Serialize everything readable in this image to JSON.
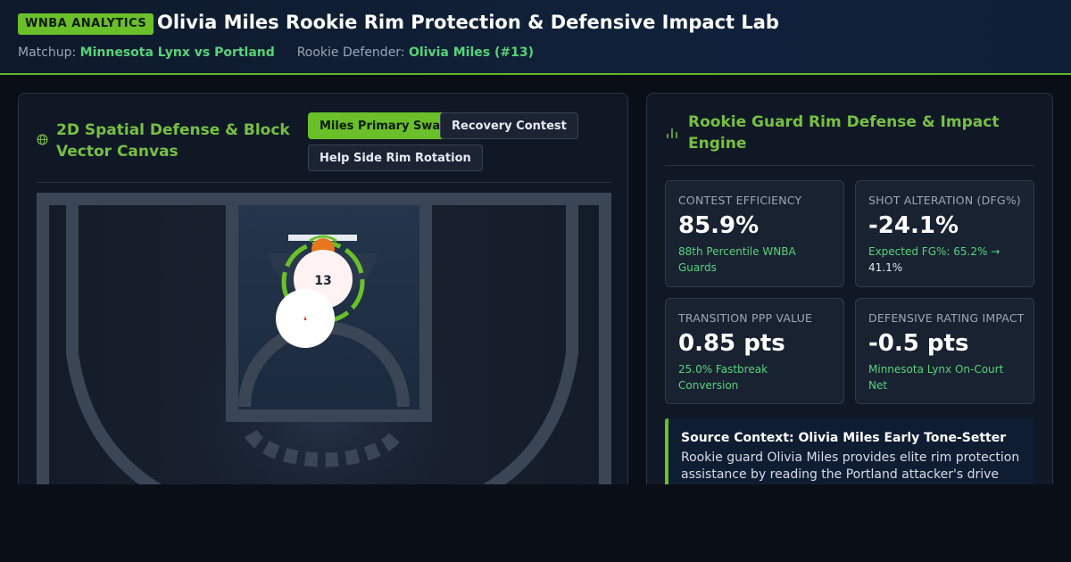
{
  "header": {
    "badge": "WNBA ANALYTICS",
    "title": "Olivia Miles Rookie Rim Protection & Defensive Impact Lab",
    "matchup_label": "Matchup:",
    "matchup_value": "Minnesota Lynx vs Portland",
    "defender_label": "Rookie Defender:",
    "defender_value": "Olivia Miles (#13)"
  },
  "left_panel": {
    "icon": "globe-icon",
    "title": "2D Spatial Defense & Block Vector Canvas",
    "buttons": [
      {
        "label": "Miles Primary Swat",
        "active": true
      },
      {
        "label": "Recovery Contest",
        "active": false
      },
      {
        "label": "Help Side Rim Rotation",
        "active": false
      }
    ],
    "court": {
      "defender_number": "13",
      "colors": {
        "accent": "#6bbf2a",
        "ball": "#e8761c",
        "court_line": "#3a4556"
      }
    }
  },
  "right_panel": {
    "icon": "bar-chart-icon",
    "title": "Rookie Guard Rim Defense & Impact Engine",
    "stats": [
      {
        "label": "CONTEST EFFICIENCY",
        "value": "85.9%",
        "note": "88th Percentile WNBA Guards",
        "note_extra": ""
      },
      {
        "label": "SHOT ALTERATION (DFG%)",
        "value": "-24.1%",
        "note": "Expected FG%: 65.2% →",
        "note_extra": "41.1%"
      },
      {
        "label": "TRANSITION PPP VALUE",
        "value": "0.85 pts",
        "note": "25.0% Fastbreak Conversion",
        "note_extra": ""
      },
      {
        "label": "DEFENSIVE RATING IMPACT",
        "value": "-0.5 pts",
        "note": "Minnesota Lynx On-Court Net",
        "note_extra": ""
      }
    ],
    "source": {
      "title": "Source Context: Olivia Miles Early Tone-Setter",
      "body": "Rookie guard Olivia Miles provides elite rim protection assistance by reading the Portland attacker's drive"
    }
  },
  "colors": {
    "accent": "#6bbf2a",
    "positive": "#56d37a",
    "panel_bg": "#101826",
    "page_bg": "#0a0e16"
  }
}
